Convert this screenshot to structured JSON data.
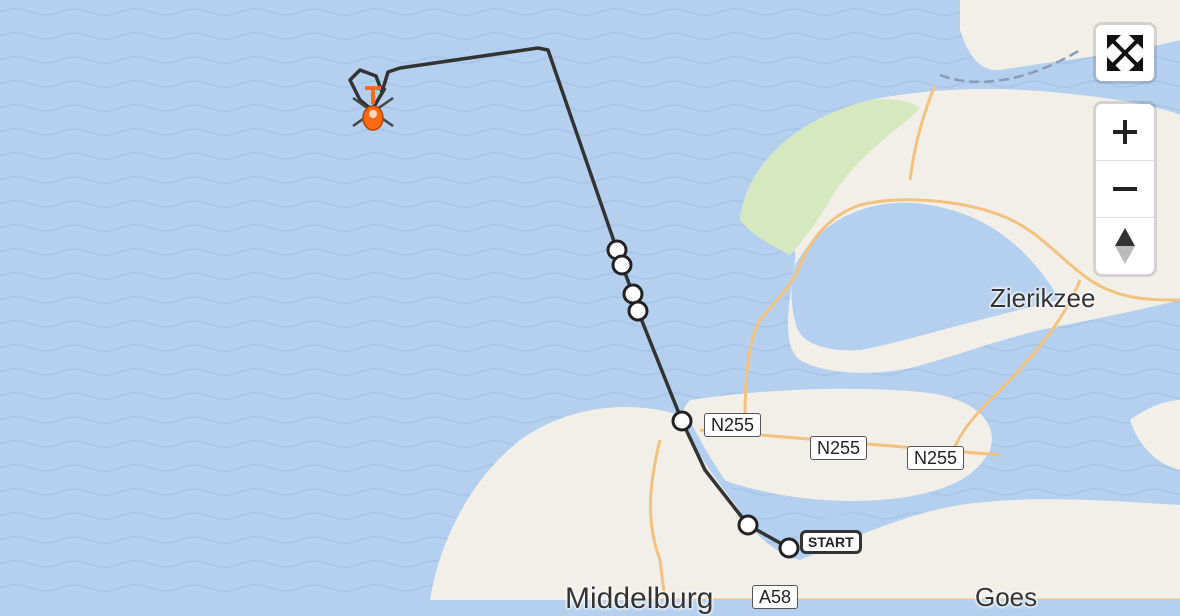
{
  "map": {
    "water_color": "#b5d0ee",
    "land_color": "#f2efe9",
    "route_color": "#333333",
    "road_color": "#f2c27e",
    "dune_color": "#d6e8c0"
  },
  "labels": {
    "zierikzee": "Zierikzee",
    "middelburg": "Middelburg",
    "goes": "Goes"
  },
  "road_shields": {
    "n255_a": "N255",
    "n255_b": "N255",
    "n255_c": "N255",
    "a58": "A58"
  },
  "route": {
    "start_label": "START",
    "end_marker_icon": "helicopter-icon"
  },
  "controls": {
    "fullscreen_icon": "fullscreen-icon",
    "zoom_in_icon": "zoom-in-icon",
    "zoom_out_icon": "zoom-out-icon",
    "compass_icon": "compass-icon"
  }
}
